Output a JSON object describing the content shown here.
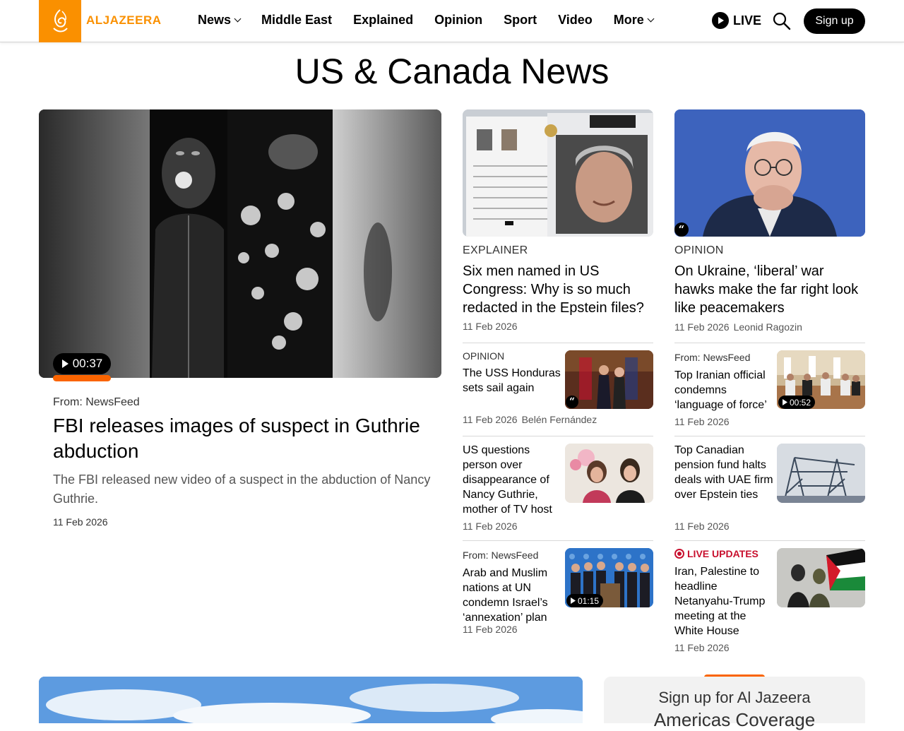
{
  "header": {
    "logo_text": "ALJAZEERA",
    "nav": [
      {
        "label": "News",
        "dropdown": true
      },
      {
        "label": "Middle East",
        "dropdown": false
      },
      {
        "label": "Explained",
        "dropdown": false
      },
      {
        "label": "Opinion",
        "dropdown": false
      },
      {
        "label": "Sport",
        "dropdown": false
      },
      {
        "label": "Video",
        "dropdown": false
      },
      {
        "label": "More",
        "dropdown": true
      }
    ],
    "live_label": "LIVE",
    "signup_label": "Sign up"
  },
  "page_title": "US & Canada News",
  "hero": {
    "duration": "00:37",
    "from": "From: NewsFeed",
    "title": "FBI releases images of suspect in Guthrie abduction",
    "description": "The FBI released new video of a suspect in the abduction of Nancy Guthrie.",
    "date": "11 Feb 2026"
  },
  "col2_top": {
    "kicker": "EXPLAINER",
    "title": "Six men named in US Congress: Why is so much redacted in the Epstein files?",
    "date": "11 Feb 2026"
  },
  "col3_top": {
    "kicker": "OPINION",
    "title": "On Ukraine, ‘liberal’ war hawks make the far right look like peacemakers",
    "date": "11 Feb 2026",
    "author": "Leonid Ragozin"
  },
  "col2_items": [
    {
      "kicker": "OPINION",
      "title": "The USS Honduras sets sail again",
      "date": "11 Feb 2026",
      "author": "Belén Fernández"
    },
    {
      "kicker": "",
      "title": "US questions person over disappearance of Nancy Guthrie, mother of TV host",
      "date": "11 Feb 2026"
    },
    {
      "kicker": "From: NewsFeed",
      "title": "Arab and Muslim nations at UN condemn Israel’s ‘annexation’ plan",
      "date": "11 Feb 2026",
      "duration": "01:15"
    }
  ],
  "col3_items": [
    {
      "kicker": "From: NewsFeed",
      "title": "Top Iranian official condemns ‘language of force’",
      "date": "11 Feb 2026",
      "duration": "00:52"
    },
    {
      "kicker": "",
      "title": "Top Canadian pension fund halts deals with UAE firm over Epstein ties",
      "date": "11 Feb 2026"
    },
    {
      "kicker": "LIVE UPDATES",
      "title": "Iran, Palestine to headline Netanyahu-Trump meeting at the White House",
      "date": "11 Feb 2026"
    }
  ],
  "signup_card": {
    "line1": "Sign up for Al Jazeera",
    "line2": "Americas Coverage"
  },
  "colors": {
    "brand": "#fa9000",
    "accent": "#fa6400",
    "live": "#c8102e"
  }
}
